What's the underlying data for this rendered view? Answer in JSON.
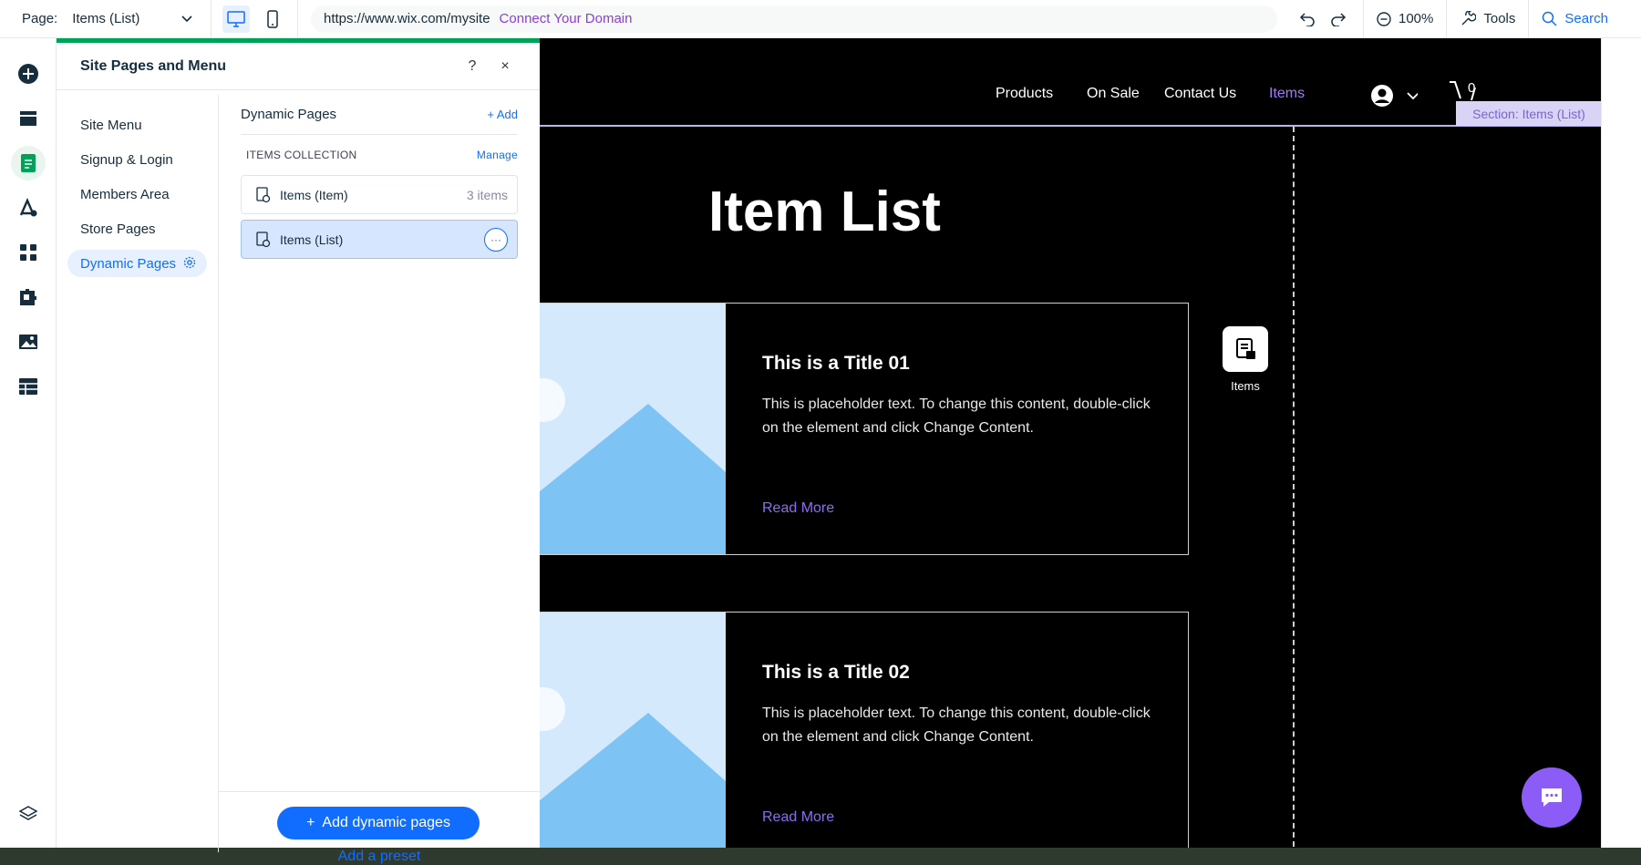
{
  "topbar": {
    "page_label": "Page:",
    "page_value": "Items (List)",
    "url": "https://www.wix.com/mysite",
    "connect_domain": "Connect Your Domain",
    "zoom": "100%",
    "tools": "Tools",
    "search": "Search"
  },
  "panel": {
    "title": "Site Pages and Menu",
    "help": "?",
    "close": "×",
    "nav": [
      {
        "label": "Site Menu"
      },
      {
        "label": "Signup & Login"
      },
      {
        "label": "Members Area"
      },
      {
        "label": "Store Pages"
      },
      {
        "label": "Dynamic Pages"
      }
    ],
    "section_title": "Dynamic Pages",
    "add_label": "+ Add",
    "collection_label": "ITEMS COLLECTION",
    "manage_label": "Manage",
    "pages": [
      {
        "label": "Items (Item)",
        "count": "3 items"
      },
      {
        "label": "Items (List)",
        "more": "···"
      }
    ],
    "add_dynamic_btn": "Add dynamic pages",
    "add_dynamic_plus": "+",
    "add_preset": "Add a preset"
  },
  "site": {
    "nav": [
      "Products",
      "On Sale",
      "Contact Us",
      "Items"
    ],
    "cart_count": "0",
    "section_label": "Section: Items (List)",
    "title": "Item List",
    "cards": [
      {
        "title": "This is a Title 01",
        "body": "This is placeholder text. To change this content, double-click on the element and click Change Content.",
        "more": "Read More"
      },
      {
        "title": "This is a Title 02",
        "body": "This is placeholder text. To change this content, double-click on the element and click Change Content.",
        "more": "Read More"
      }
    ],
    "items_badge": "Items"
  },
  "colors": {
    "accent": "#116dff",
    "active_green": "#00a25a",
    "purple": "#8a3fdb",
    "chat": "#8b5cf6"
  }
}
